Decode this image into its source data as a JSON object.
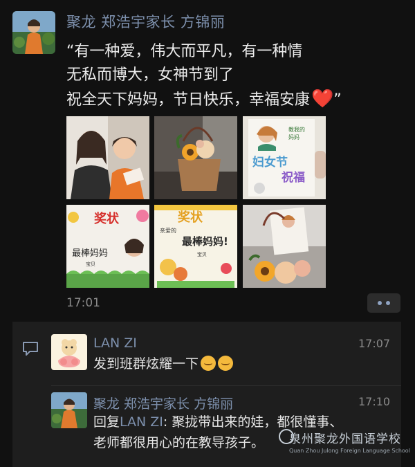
{
  "post": {
    "author": "聚龙 郑浩宇家长 方锦丽",
    "text_lines": [
      "“有一种爱，伟大而平凡，有一种情",
      "无私而博大，女神节到了",
      "祝全天下妈妈，节日快乐，幸福安康"
    ],
    "heart": "❤️",
    "closing_quote": "”",
    "time": "17:01"
  },
  "photos": {
    "photo3_lines": [
      "妇女节",
      "祝福"
    ],
    "photo4_lines": [
      "奖状",
      "最棒妈妈",
      "宝贝"
    ],
    "photo5_lines": [
      "奖状",
      "最棒妈妈!",
      "宝贝"
    ]
  },
  "comments": [
    {
      "name": "LAN ZI",
      "time": "17:07",
      "text": "发到班群炫耀一下"
    },
    {
      "name": "聚龙 郑浩宇家长 方锦丽",
      "time": "17:10",
      "reply_prefix": "回复",
      "reply_to": "LAN ZI",
      "reply_text_1": ": 聚拢带出来的娃，都很懂事、",
      "reply_text_2": "老师都很用心的在教导孩子。"
    }
  ],
  "watermark": {
    "main": "泉州聚龙外国语学校",
    "sub": "Quan Zhou Julong Foreign Language School"
  },
  "colors": {
    "background": "#111111",
    "name": "#7d90ad",
    "heart": "#f03a3a"
  },
  "icons": [
    "comment-icon",
    "more-icon"
  ]
}
